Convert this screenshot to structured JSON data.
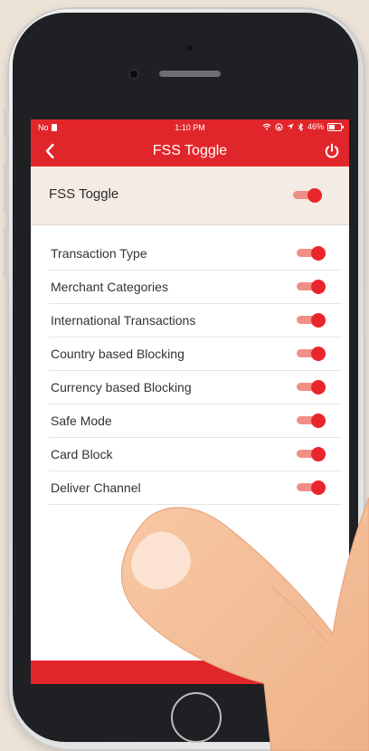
{
  "status_bar": {
    "carrier": "No",
    "time": "1:10 PM",
    "battery": "46%",
    "battery_level": 0.46
  },
  "header": {
    "title": "FSS Toggle",
    "back_icon": "chevron-left-icon",
    "power_icon": "power-icon"
  },
  "master_toggle": {
    "label": "FSS Toggle",
    "on": true
  },
  "settings": [
    {
      "label": "Transaction Type",
      "on": true
    },
    {
      "label": "Merchant Categories",
      "on": true
    },
    {
      "label": "International Transactions",
      "on": true
    },
    {
      "label": "Country based Blocking",
      "on": true
    },
    {
      "label": "Currency based Blocking",
      "on": true
    },
    {
      "label": "Safe Mode",
      "on": true
    },
    {
      "label": "Card Block",
      "on": true
    },
    {
      "label": "Deliver Channel",
      "on": true
    }
  ],
  "colors": {
    "accent": "#e1262b",
    "toggle_track": "#f08f86",
    "toggle_knob": "#e8262b",
    "panel_bg": "#f4ebe5"
  }
}
